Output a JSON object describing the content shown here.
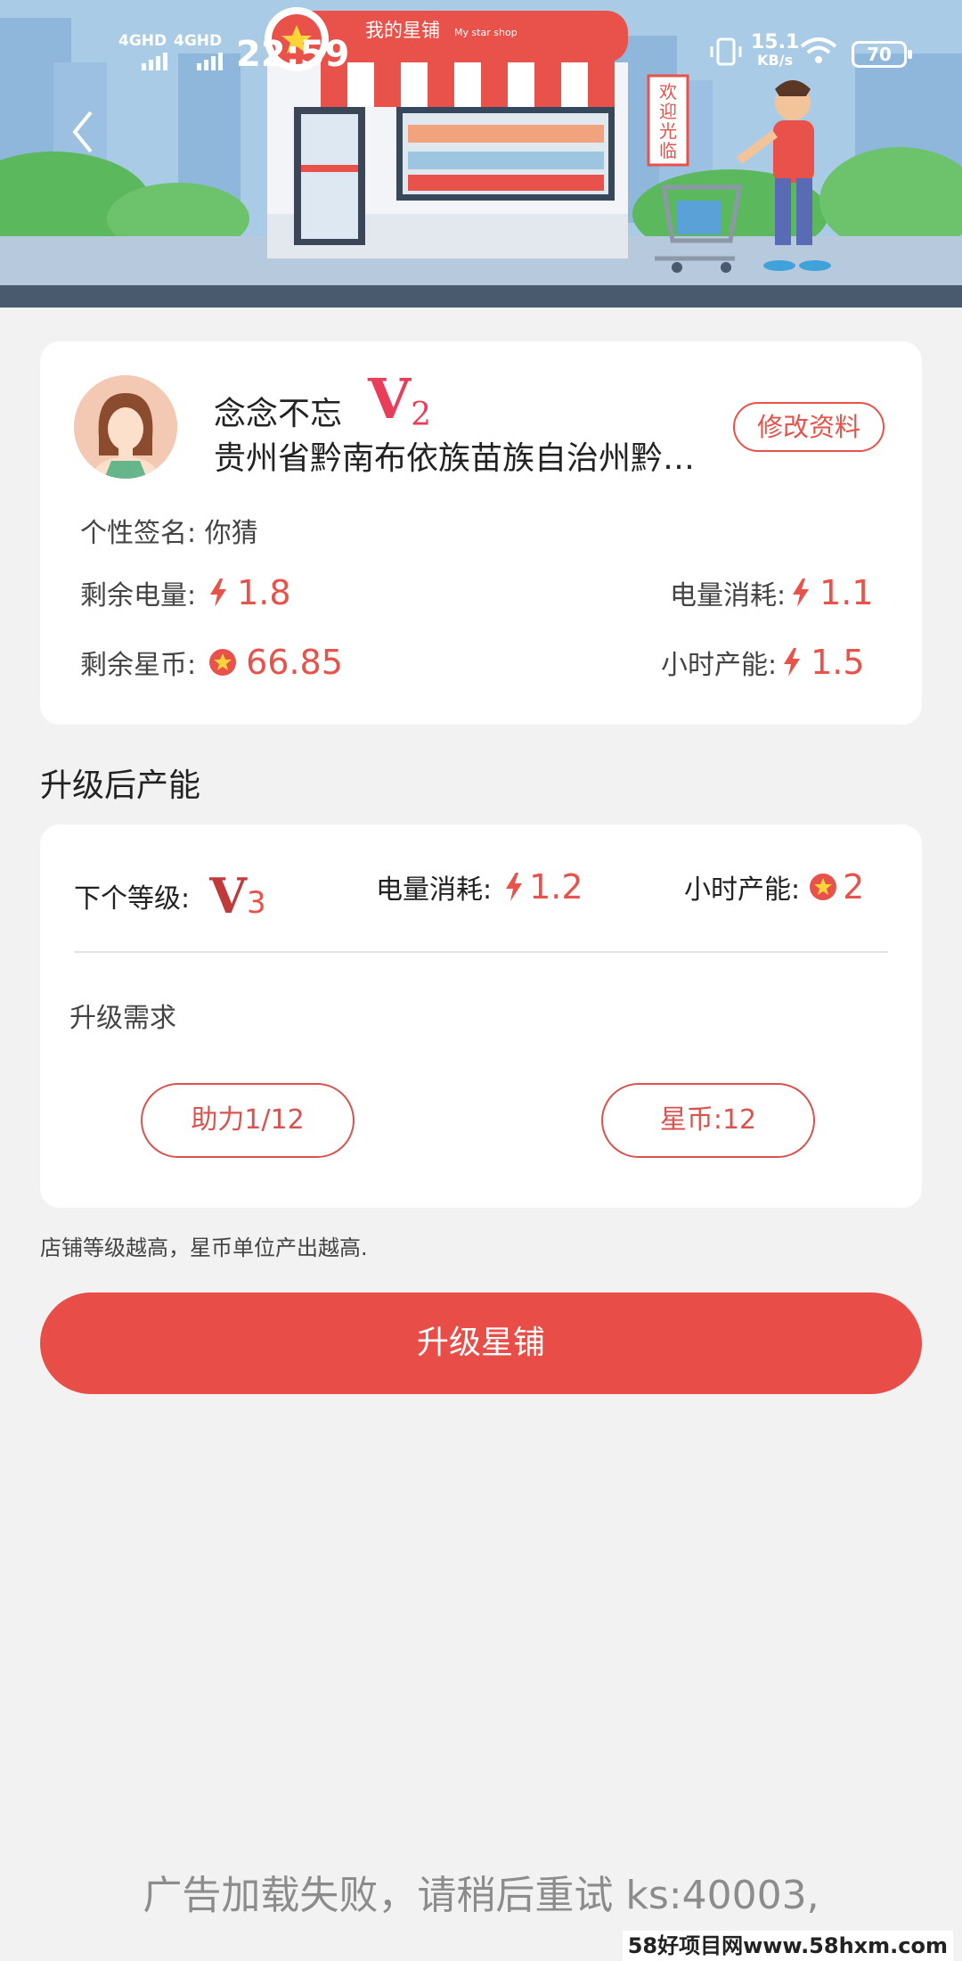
{
  "status_bar": {
    "signal_1": "4GHD",
    "signal_2": "4GHD",
    "time": "22:59",
    "speed_value": "15.1",
    "speed_unit": "KB/s",
    "battery": "70"
  },
  "banner": {
    "shop_sign_title": "我的星铺",
    "shop_sign_subtitle": "My star shop",
    "welcome_sign": "欢迎光临"
  },
  "profile": {
    "nickname": "念念不忘",
    "level_letter": "V",
    "level_number": "2",
    "address": "贵州省黔南布依族苗族自治州黔南布依族苗族自治州",
    "edit_label": "修改资料",
    "signature_label": "个性签名:",
    "signature_value": "你猜",
    "remaining_power_label": "剩余电量:",
    "remaining_power_value": "1.8",
    "power_consumption_label": "电量消耗:",
    "power_consumption_value": "1.1",
    "remaining_coins_label": "剩余星币:",
    "remaining_coins_value": "66.85",
    "hourly_output_label": "小时产能:",
    "hourly_output_value": "1.5"
  },
  "upgrade": {
    "section_title": "升级后产能",
    "next_level_label": "下个等级:",
    "next_level_letter": "V",
    "next_level_number": "3",
    "power_consumption_label": "电量消耗:",
    "power_consumption_value": "1.2",
    "hourly_output_label": "小时产能:",
    "hourly_output_value": "2",
    "requirements_title": "升级需求",
    "assist_label": "助力1/12",
    "coins_label": "星币:12",
    "hint": "店铺等级越高，星币单位产出越高.",
    "upgrade_button": "升级星铺"
  },
  "ad_error": "广告加载失败，请稍后重试 ks:40003,",
  "watermark": "58好项目网www.58hxm.com",
  "colors": {
    "accent": "#e84e47",
    "level": "#e83e5a",
    "background": "#f2f2f2"
  }
}
